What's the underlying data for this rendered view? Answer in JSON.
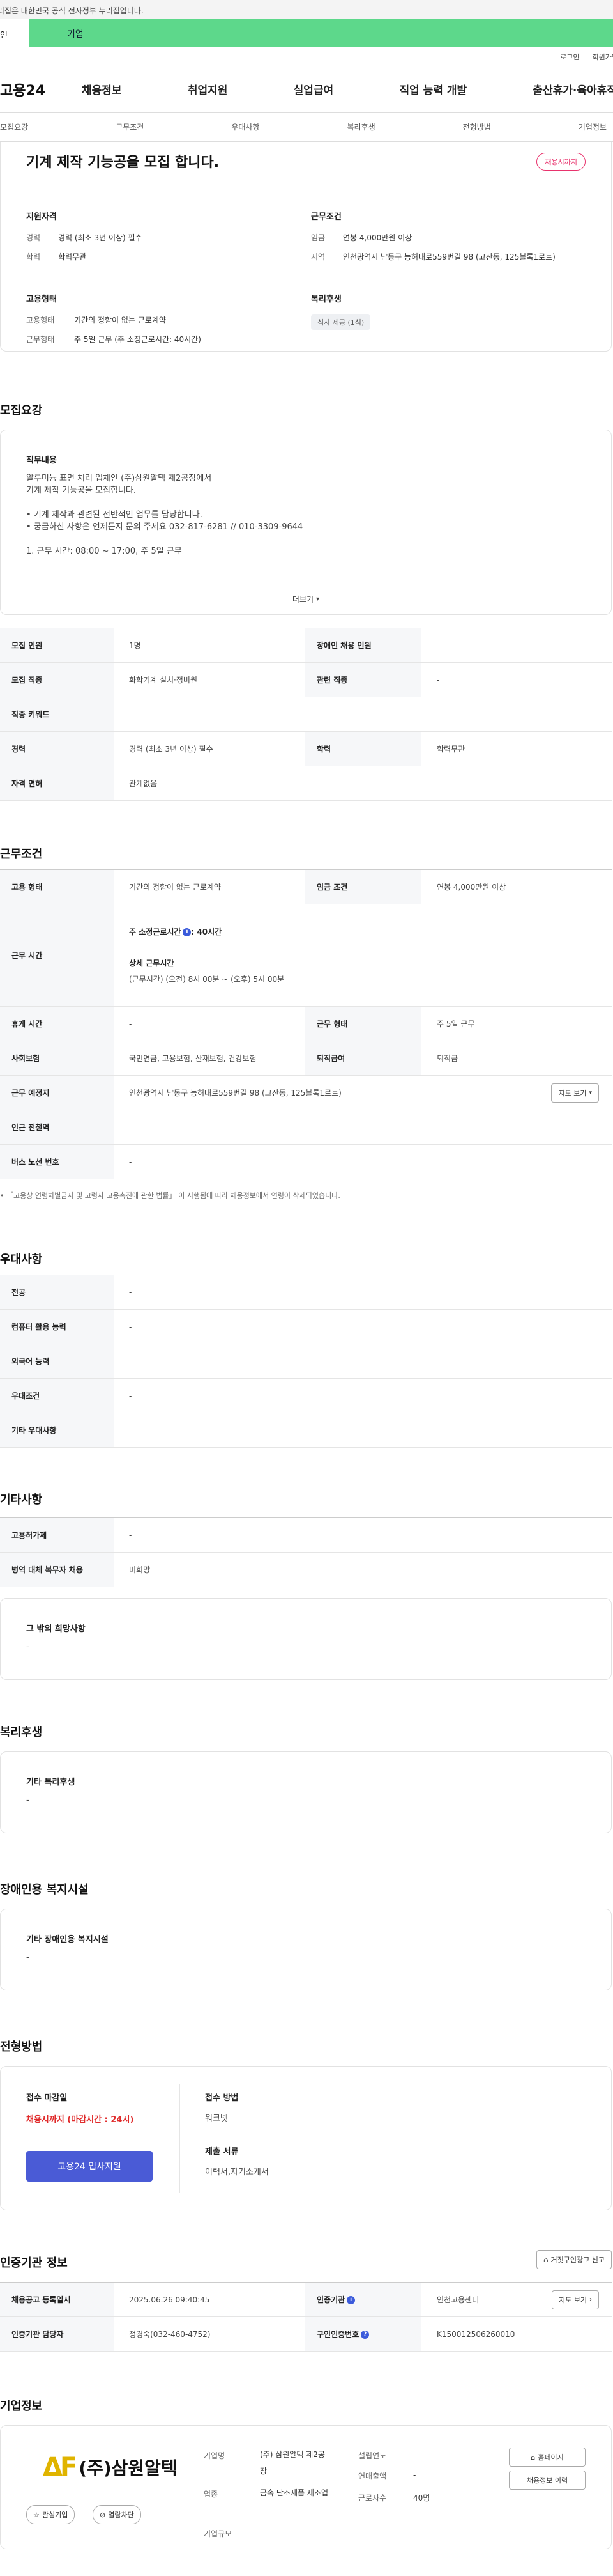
{
  "banner": {
    "text": "이 누리집은 대한민국 공식 전자정부 누리집입니다."
  },
  "tabs": {
    "personal": "개인",
    "company": "기업"
  },
  "util": {
    "login": "로그인",
    "signup": "회원가입"
  },
  "header": {
    "logo": "고용24",
    "nav": [
      "채용정보",
      "취업지원",
      "실업급여",
      "직업 능력 개발",
      "출산휴가·육아휴직"
    ]
  },
  "subnav": [
    "모집요강",
    "근무조건",
    "우대사항",
    "복리후생",
    "전형방법",
    "기업정보"
  ],
  "job": {
    "title": "기계 제작 기능공을 모집 합니다.",
    "deadline_badge": "채용시까지",
    "qual_head": "지원자격",
    "qual": [
      {
        "k": "경력",
        "v": "경력 (최소 3년 이상) 필수"
      },
      {
        "k": "학력",
        "v": "학력무관"
      }
    ],
    "cond_head": "근무조건",
    "cond": [
      {
        "k": "임금",
        "v": "연봉 4,000만원 이상"
      },
      {
        "k": "지역",
        "v": "인천광역시 남동구 능허대로559번길 98 (고잔동, 125블록1로트)"
      }
    ],
    "emp_head": "고용형태",
    "emp": [
      {
        "k": "고용형태",
        "v": "기간의 정함이 없는 근로계약"
      },
      {
        "k": "근무형태",
        "v": "주 5일 근무 (주 소정근로시간: 40시간)"
      }
    ],
    "welfare_head": "복리후생",
    "welfare_tag": "식사 제공 (1식)"
  },
  "recruit": {
    "section_title": "모집요강",
    "duty_label": "직무내용",
    "duty_lines": [
      "알루미늄 표면 처리 업체인 (주)삼원알텍 제2공장에서",
      "기계 제작 기능공을 모집합니다.",
      "",
      "• 기계 제작과 관련된 전반적인 업무를 담당합니다.",
      "• 궁금하신 사항은 언제든지 문의 주세요   032-817-6281   //   010-3309-9644",
      "",
      "1. 근무 시간: 08:00 ~ 17:00, 주 5일 근무"
    ],
    "more": "더보기",
    "rows": [
      {
        "k1": "모집 인원",
        "v1": "1명",
        "k2": "장애인 채용 인원",
        "v2": "-"
      },
      {
        "k1": "모집 직종",
        "v1": "화학기계 설치·정비원",
        "k2": "관련 직종",
        "v2": "-"
      },
      {
        "k1": "직종 키워드",
        "v1": "-"
      },
      {
        "k1": "경력",
        "v1": "경력 (최소 3년 이상) 필수",
        "k2": "학력",
        "v2": "학력무관"
      },
      {
        "k1": "자격 면허",
        "v1": "관계없음"
      }
    ]
  },
  "work": {
    "section_title": "근무조건",
    "emp_type_k": "고용 형태",
    "emp_type_v": "기간의 정함이 없는 근로계약",
    "wage_k": "임금 조건",
    "wage_v": "연봉 4,000만원 이상",
    "hours_k": "근무 시간",
    "hours_weekly": "주 소정근로시간",
    "hours_weekly_val": ": 40시간",
    "hours_detail_label": "상세 근무시간",
    "hours_detail": "(근무시간) (오전) 8시 00분 ~ (오후) 5시 00분",
    "break_k": "휴게 시간",
    "break_v": "-",
    "form_k": "근무 형태",
    "form_v": "주 5일 근무",
    "insurance_k": "사회보험",
    "insurance_v": "국민연금, 고용보험, 산재보험, 건강보험",
    "retire_k": "퇴직급여",
    "retire_v": "퇴직금",
    "place_k": "근무 예정지",
    "place_v": "인천광역시 남동구 능허대로559번길 98 (고잔동, 125블록1로트)",
    "map_btn": "지도 보기",
    "subway_k": "인근 전철역",
    "subway_v": "-",
    "bus_k": "버스 노선 번호",
    "bus_v": "-",
    "note": "「고용상 연령차별금지 및 고령자 고용촉진에 관한 법률」 이 시행됨에 따라 채용정보에서 연령이 삭제되었습니다."
  },
  "pref": {
    "section_title": "우대사항",
    "rows": [
      {
        "k": "전공",
        "v": "-"
      },
      {
        "k": "컴퓨터 활용 능력",
        "v": "-"
      },
      {
        "k": "외국어 능력",
        "v": "-"
      },
      {
        "k": "우대조건",
        "v": "-"
      },
      {
        "k": "기타 우대사항",
        "v": "-"
      }
    ]
  },
  "etc": {
    "section_title": "기타사항",
    "rows": [
      {
        "k": "고용허가제",
        "v": "-"
      },
      {
        "k": "병역 대체 복무자 채용",
        "v": "비희망"
      }
    ],
    "other_label": "그 밖의 희망사항",
    "other_value": "-"
  },
  "welfare": {
    "section_title": "복리후생",
    "label": "기타 복리후생",
    "value": "-"
  },
  "disabled": {
    "section_title": "장애인용 복지시설",
    "label": "기타 장애인용 복지시설",
    "value": "-"
  },
  "selection": {
    "section_title": "전형방법",
    "deadline_label": "접수 마감일",
    "deadline_value": "채용시까지 (마감시간 : 24시)",
    "apply_btn": "고용24 입사지원",
    "method_label": "접수 방법",
    "method_value": "워크넷",
    "docs_label": "제출 서류",
    "docs_value": "이력서,자기소개서"
  },
  "agency": {
    "section_title": "인증기관 정보",
    "report_btn": "거짓구인광고 신고",
    "reg_k": "채용공고 등록일시",
    "reg_v": "2025.06.26 09:40:45",
    "org_k": "인증기관",
    "org_v": "인천고용센터",
    "map_btn": "지도 보기",
    "staff_k": "인증기관 담당자",
    "staff_v": "정경숙(032-460-4752)",
    "num_k": "구인인증번호",
    "num_v": "K150012506260010"
  },
  "company": {
    "section_title": "기업정보",
    "logo_text": "(주)삼원알텍",
    "interest_btn": "관심기업",
    "block_btn": "열람차단",
    "name_k": "기업명",
    "name_v": "(주) 삼원알텍 제2공장",
    "industry_k": "업종",
    "industry_v": "금속 단조제품 제조업",
    "size_k": "기업규모",
    "size_v": "-",
    "year_k": "설립연도",
    "year_v": "-",
    "sales_k": "연매출액",
    "sales_v": "-",
    "staff_k": "근로자수",
    "staff_v": "40명",
    "homepage_btn": "홈페이지",
    "jobs_btn": "채용정보 이력"
  },
  "colors": {
    "tab_company": "#5dd88b",
    "badge": "#e8336d",
    "apply": "#4a5bd6",
    "deadline": "#e02b2b"
  }
}
